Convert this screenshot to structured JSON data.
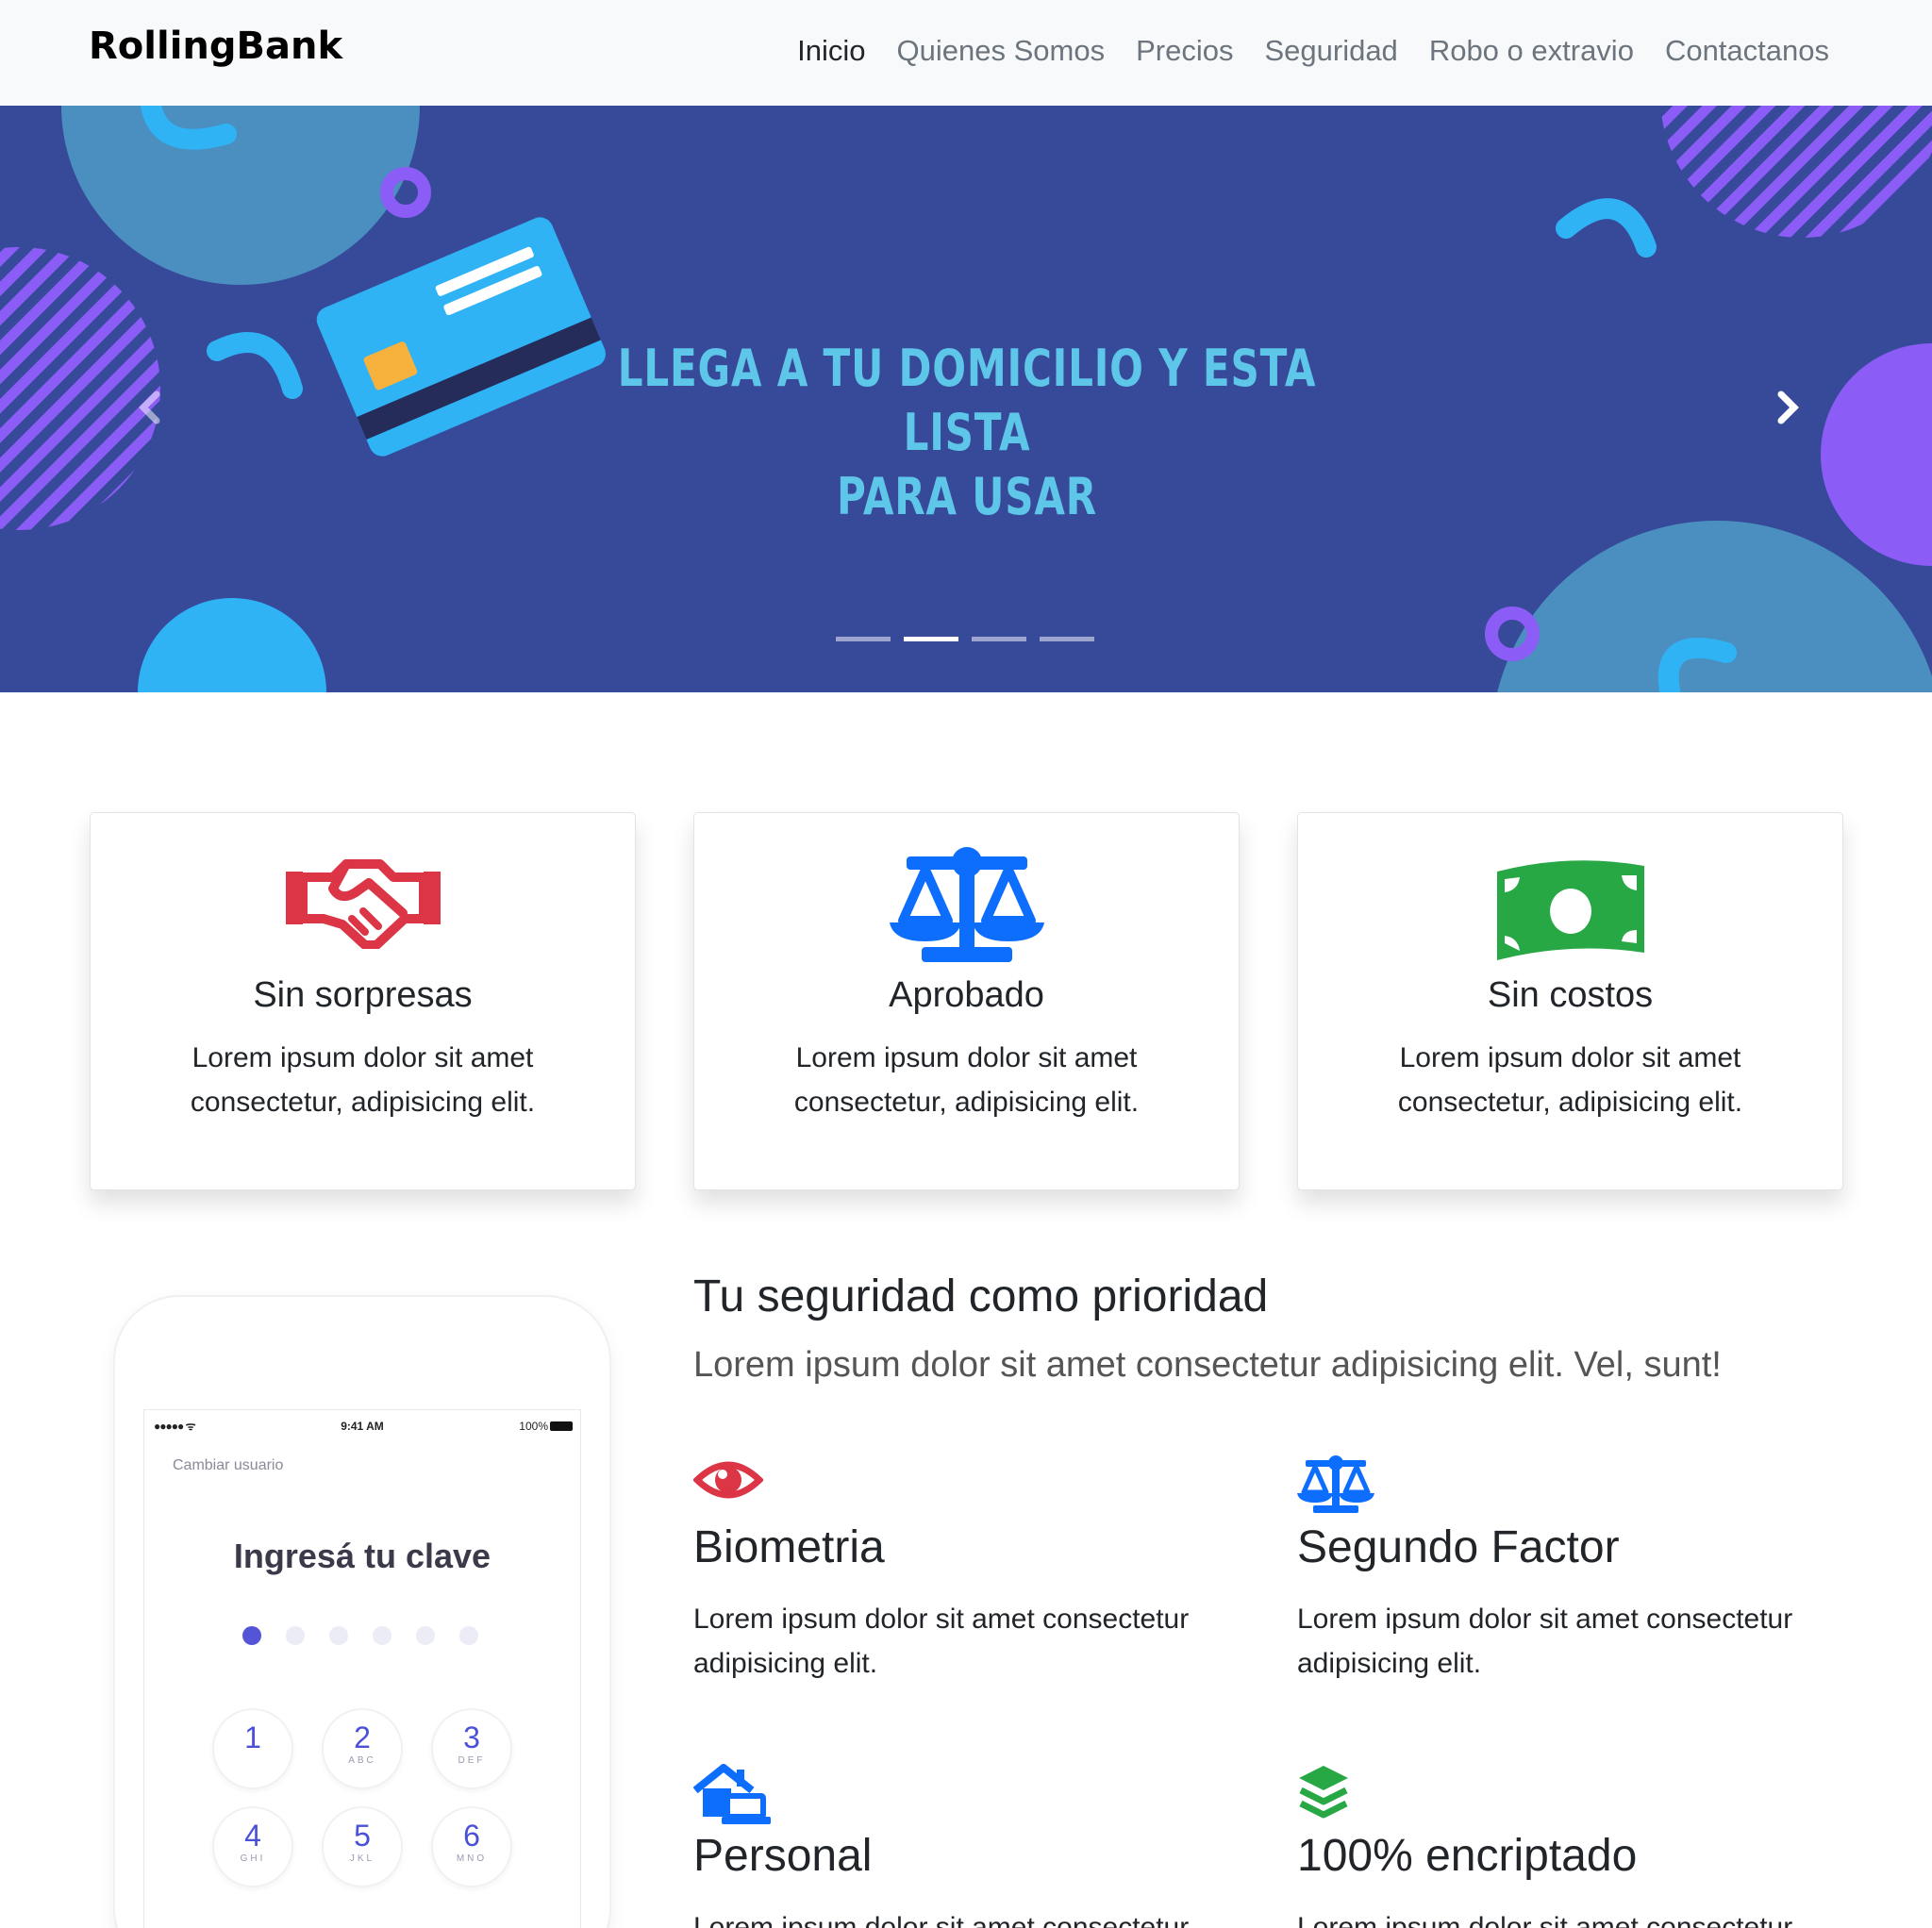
{
  "brand": "RollingBank",
  "nav": {
    "items": [
      "Inicio",
      "Quienes Somos",
      "Precios",
      "Seguridad",
      "Robo o extravio",
      "Contactanos"
    ],
    "active": "Inicio"
  },
  "carousel": {
    "headline_line1": "LLEGA A TU DOMICILIO Y ESTA LISTA",
    "headline_line2": "PARA USAR",
    "slide_count": 4,
    "active_slide": 2,
    "prev_icon": "chevron-left-icon",
    "next_icon": "chevron-right-icon"
  },
  "cards": [
    {
      "icon": "handshake-icon",
      "icon_color": "#dc3545",
      "title": "Sin sorpresas",
      "text": "Lorem ipsum dolor sit amet consectetur, adipisicing elit."
    },
    {
      "icon": "balance-scale-icon",
      "icon_color": "#0d6efd",
      "title": "Aprobado",
      "text": "Lorem ipsum dolor sit amet consectetur, adipisicing elit."
    },
    {
      "icon": "money-bill-icon",
      "icon_color": "#28a745",
      "title": "Sin costos",
      "text": "Lorem ipsum dolor sit amet consectetur, adipisicing elit."
    }
  ],
  "phone": {
    "status_time": "9:41 AM",
    "status_battery": "100%",
    "change_user": "Cambiar usuario",
    "enter_key": "Ingresá tu clave",
    "keys": [
      {
        "num": "1",
        "letters": ""
      },
      {
        "num": "2",
        "letters": "ABC"
      },
      {
        "num": "3",
        "letters": "DEF"
      },
      {
        "num": "4",
        "letters": "GHI"
      },
      {
        "num": "5",
        "letters": "JKL"
      },
      {
        "num": "6",
        "letters": "MNO"
      }
    ]
  },
  "security": {
    "title": "Tu seguridad como prioridad",
    "lead": "Lorem ipsum dolor sit amet consectetur adipisicing elit. Vel, sunt!",
    "features": [
      {
        "icon": "eye-icon",
        "icon_color": "#dc3545",
        "title": "Biometria",
        "text": "Lorem ipsum dolor sit amet consectetur adipisicing elit."
      },
      {
        "icon": "balance-scale-icon",
        "icon_color": "#0d6efd",
        "title": "Segundo Factor",
        "text": "Lorem ipsum dolor sit amet consectetur adipisicing elit."
      },
      {
        "icon": "house-laptop-icon",
        "icon_color": "#0d6efd",
        "title": "Personal",
        "text": "Lorem ipsum dolor sit amet consectetur adipisicing elit."
      },
      {
        "icon": "layer-group-icon",
        "icon_color": "#28a745",
        "title": "100% encriptado",
        "text": "Lorem ipsum dolor sit amet consectetur adipisicing elit."
      }
    ]
  }
}
